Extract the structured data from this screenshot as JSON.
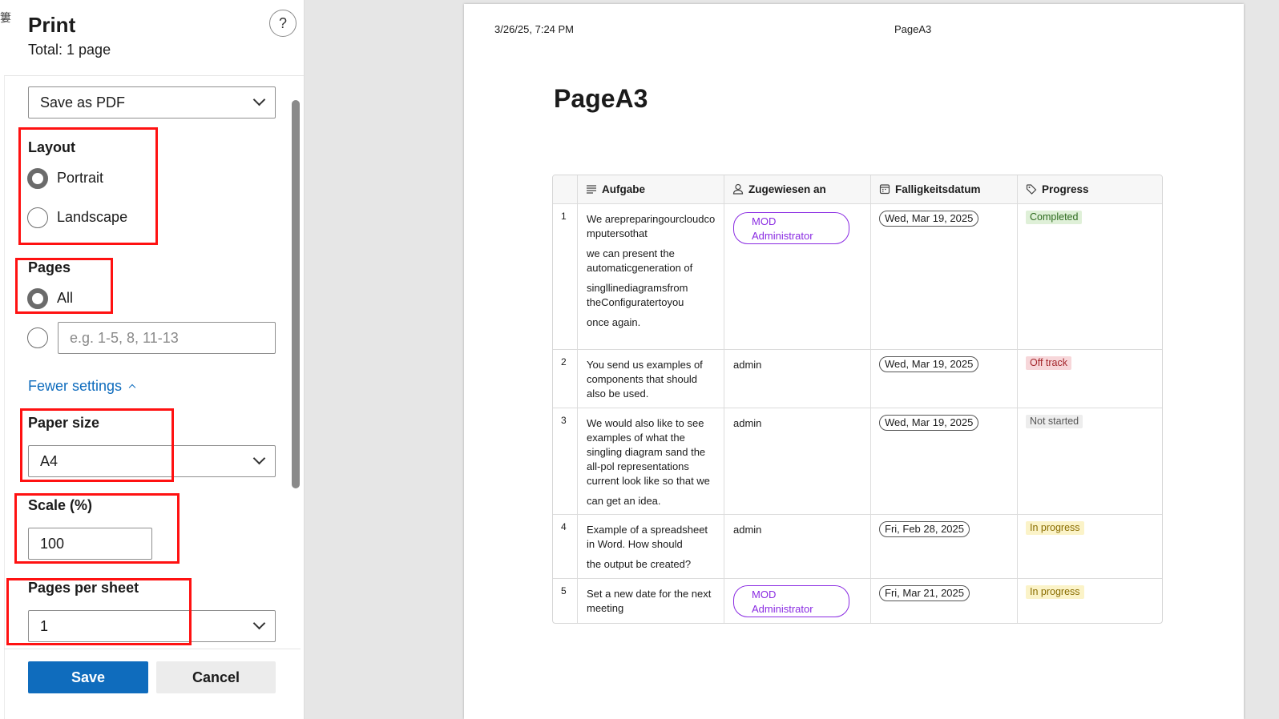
{
  "dialog": {
    "title": "Print",
    "total": "Total: 1 page",
    "help": "?",
    "printer": "Save as PDF",
    "layout": {
      "label": "Layout",
      "options": [
        "Portrait",
        "Landscape"
      ],
      "selected": "Portrait"
    },
    "pages": {
      "label": "Pages",
      "all": "All",
      "range_placeholder": "e.g. 1-5, 8, 11-13"
    },
    "fewer_settings": "Fewer settings",
    "paper_size": {
      "label": "Paper size",
      "value": "A4"
    },
    "scale": {
      "label": "Scale (%)",
      "value": "100"
    },
    "pages_per_sheet": {
      "label": "Pages per sheet",
      "value": "1"
    },
    "save_label": "Save",
    "cancel_label": "Cancel"
  },
  "preview": {
    "header_date": "3/26/25, 7:24 PM",
    "header_name": "PageA3",
    "doc_title": "PageA3",
    "columns": [
      "Aufgabe",
      "Zugewiesen an",
      "Falligkeitsdatum",
      "Progress"
    ],
    "rows": [
      {
        "num": "1",
        "task": [
          "We arepreparingourcloudcomputersothat",
          "we can present the automaticgeneration of",
          "singllinediagramsfrom theConfiguratertoyou",
          "once again."
        ],
        "assigned": "MOD Administrator",
        "due": "Wed, Mar 19, 2025",
        "progress": "Completed"
      },
      {
        "num": "2",
        "task": [
          "You send us examples of components that should also be used."
        ],
        "assigned": "admin",
        "due": "Wed, Mar 19, 2025",
        "progress": "Off track"
      },
      {
        "num": "3",
        "task": [
          "We would also like to see examples of what the singling diagram sand the all-pol representations current look like so that we",
          "can get an idea."
        ],
        "assigned": "admin",
        "due": "Wed, Mar 19, 2025",
        "progress": "Not started"
      },
      {
        "num": "4",
        "task": [
          "Example of a spreadsheet in Word. How should",
          "the output be created?"
        ],
        "assigned": "admin",
        "due": "Fri, Feb 28, 2025",
        "progress": "In progress"
      },
      {
        "num": "5",
        "task": [
          "Set a new date for the next meeting"
        ],
        "assigned": "MOD Administrator",
        "due": "Fri, Mar 21, 2025",
        "progress": "In progress"
      }
    ]
  },
  "colors": {
    "accent": "#0f6cbd",
    "annotation_red": "#ff1111",
    "person_purple": "#8a2be2",
    "completed_bg": "#dff0d8",
    "offtrack_bg": "#f7d7da",
    "notstarted_bg": "#ededed",
    "inprogress_bg": "#fbf3c8"
  }
}
